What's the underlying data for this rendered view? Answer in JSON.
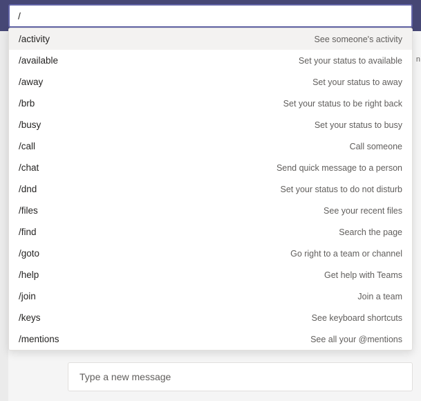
{
  "search": {
    "value": "/"
  },
  "commands": [
    {
      "name": "/activity",
      "desc": "See someone's activity",
      "highlight": true
    },
    {
      "name": "/available",
      "desc": "Set your status to available",
      "highlight": false
    },
    {
      "name": "/away",
      "desc": "Set your status to away",
      "highlight": false
    },
    {
      "name": "/brb",
      "desc": "Set your status to be right back",
      "highlight": false
    },
    {
      "name": "/busy",
      "desc": "Set your status to busy",
      "highlight": false
    },
    {
      "name": "/call",
      "desc": "Call someone",
      "highlight": false
    },
    {
      "name": "/chat",
      "desc": "Send quick message to a person",
      "highlight": false
    },
    {
      "name": "/dnd",
      "desc": "Set your status to do not disturb",
      "highlight": false
    },
    {
      "name": "/files",
      "desc": "See your recent files",
      "highlight": false
    },
    {
      "name": "/find",
      "desc": "Search the page",
      "highlight": false
    },
    {
      "name": "/goto",
      "desc": "Go right to a team or channel",
      "highlight": false
    },
    {
      "name": "/help",
      "desc": "Get help with Teams",
      "highlight": false
    },
    {
      "name": "/join",
      "desc": "Join a team",
      "highlight": false
    },
    {
      "name": "/keys",
      "desc": "See keyboard shortcuts",
      "highlight": false
    },
    {
      "name": "/mentions",
      "desc": "See all your @mentions",
      "highlight": false
    }
  ],
  "compose": {
    "placeholder": "Type a new message"
  },
  "edge_char": "n"
}
